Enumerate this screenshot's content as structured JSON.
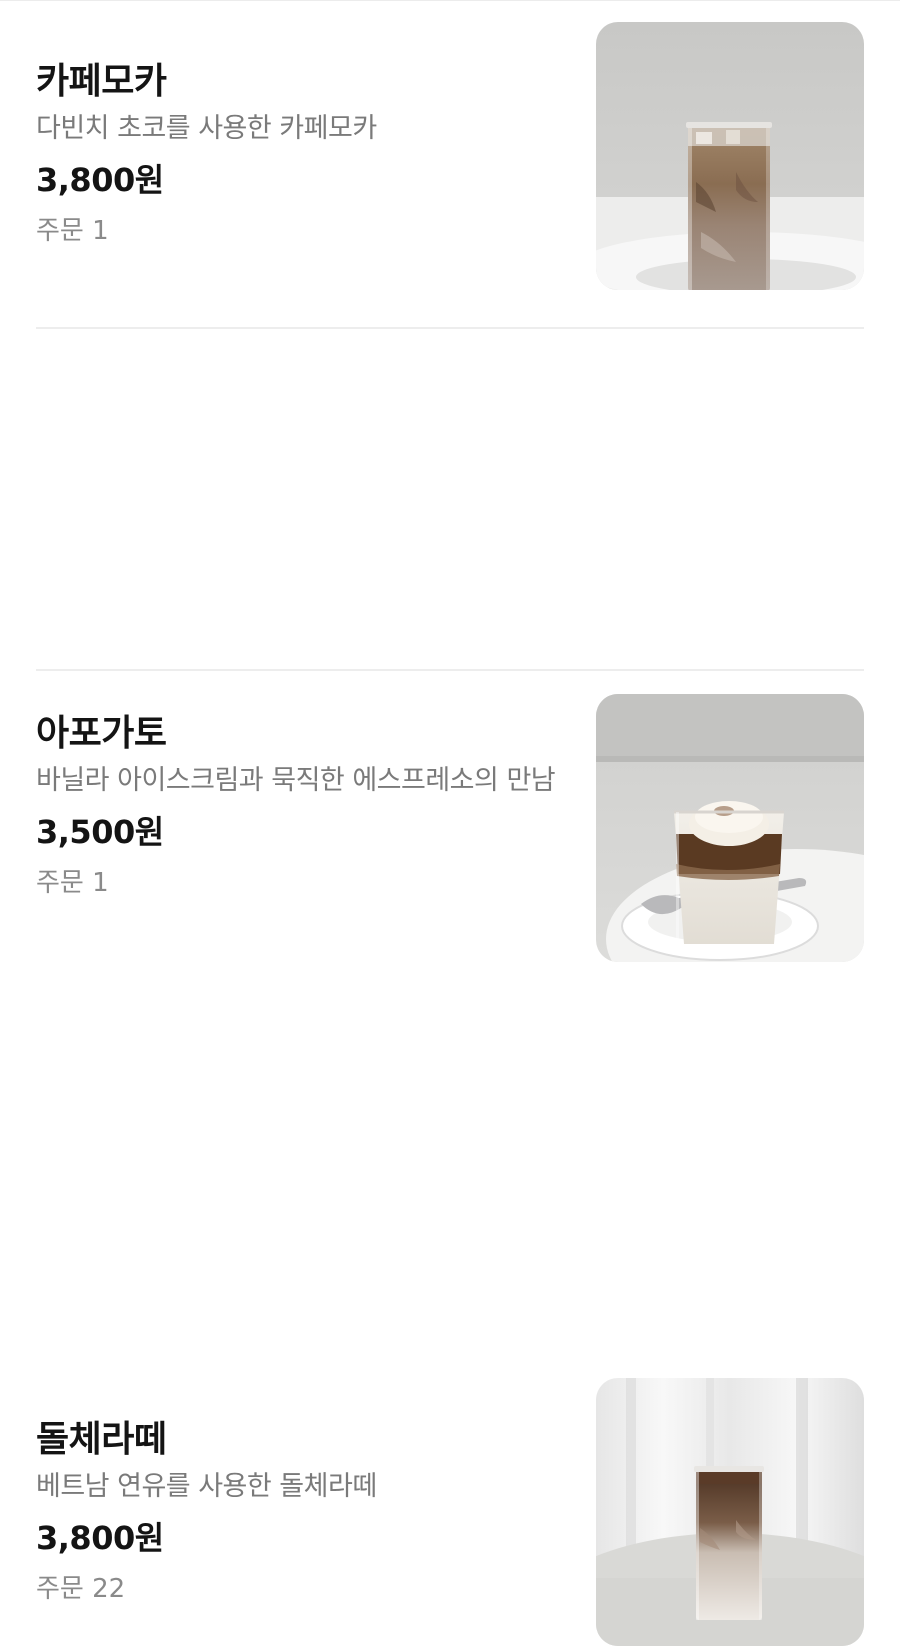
{
  "menu": {
    "items": [
      {
        "name": "카페모카",
        "description": "다빈치 초코를 사용한 카페모카",
        "price": "3,800원",
        "orders": "주문 1",
        "image_icon": "iced-cafe-mocha-photo"
      },
      {
        "name": "아포가토",
        "description": "바닐라 아이스크림과 묵직한 에스프레소의 만남",
        "price": "3,500원",
        "orders": "주문 1",
        "image_icon": "affogato-photo"
      },
      {
        "name": "돌체라떼",
        "description": "베트남 연유를 사용한 돌체라떼",
        "price": "3,800원",
        "orders": "주문 22",
        "image_icon": "iced-dolce-latte-photo"
      }
    ]
  }
}
